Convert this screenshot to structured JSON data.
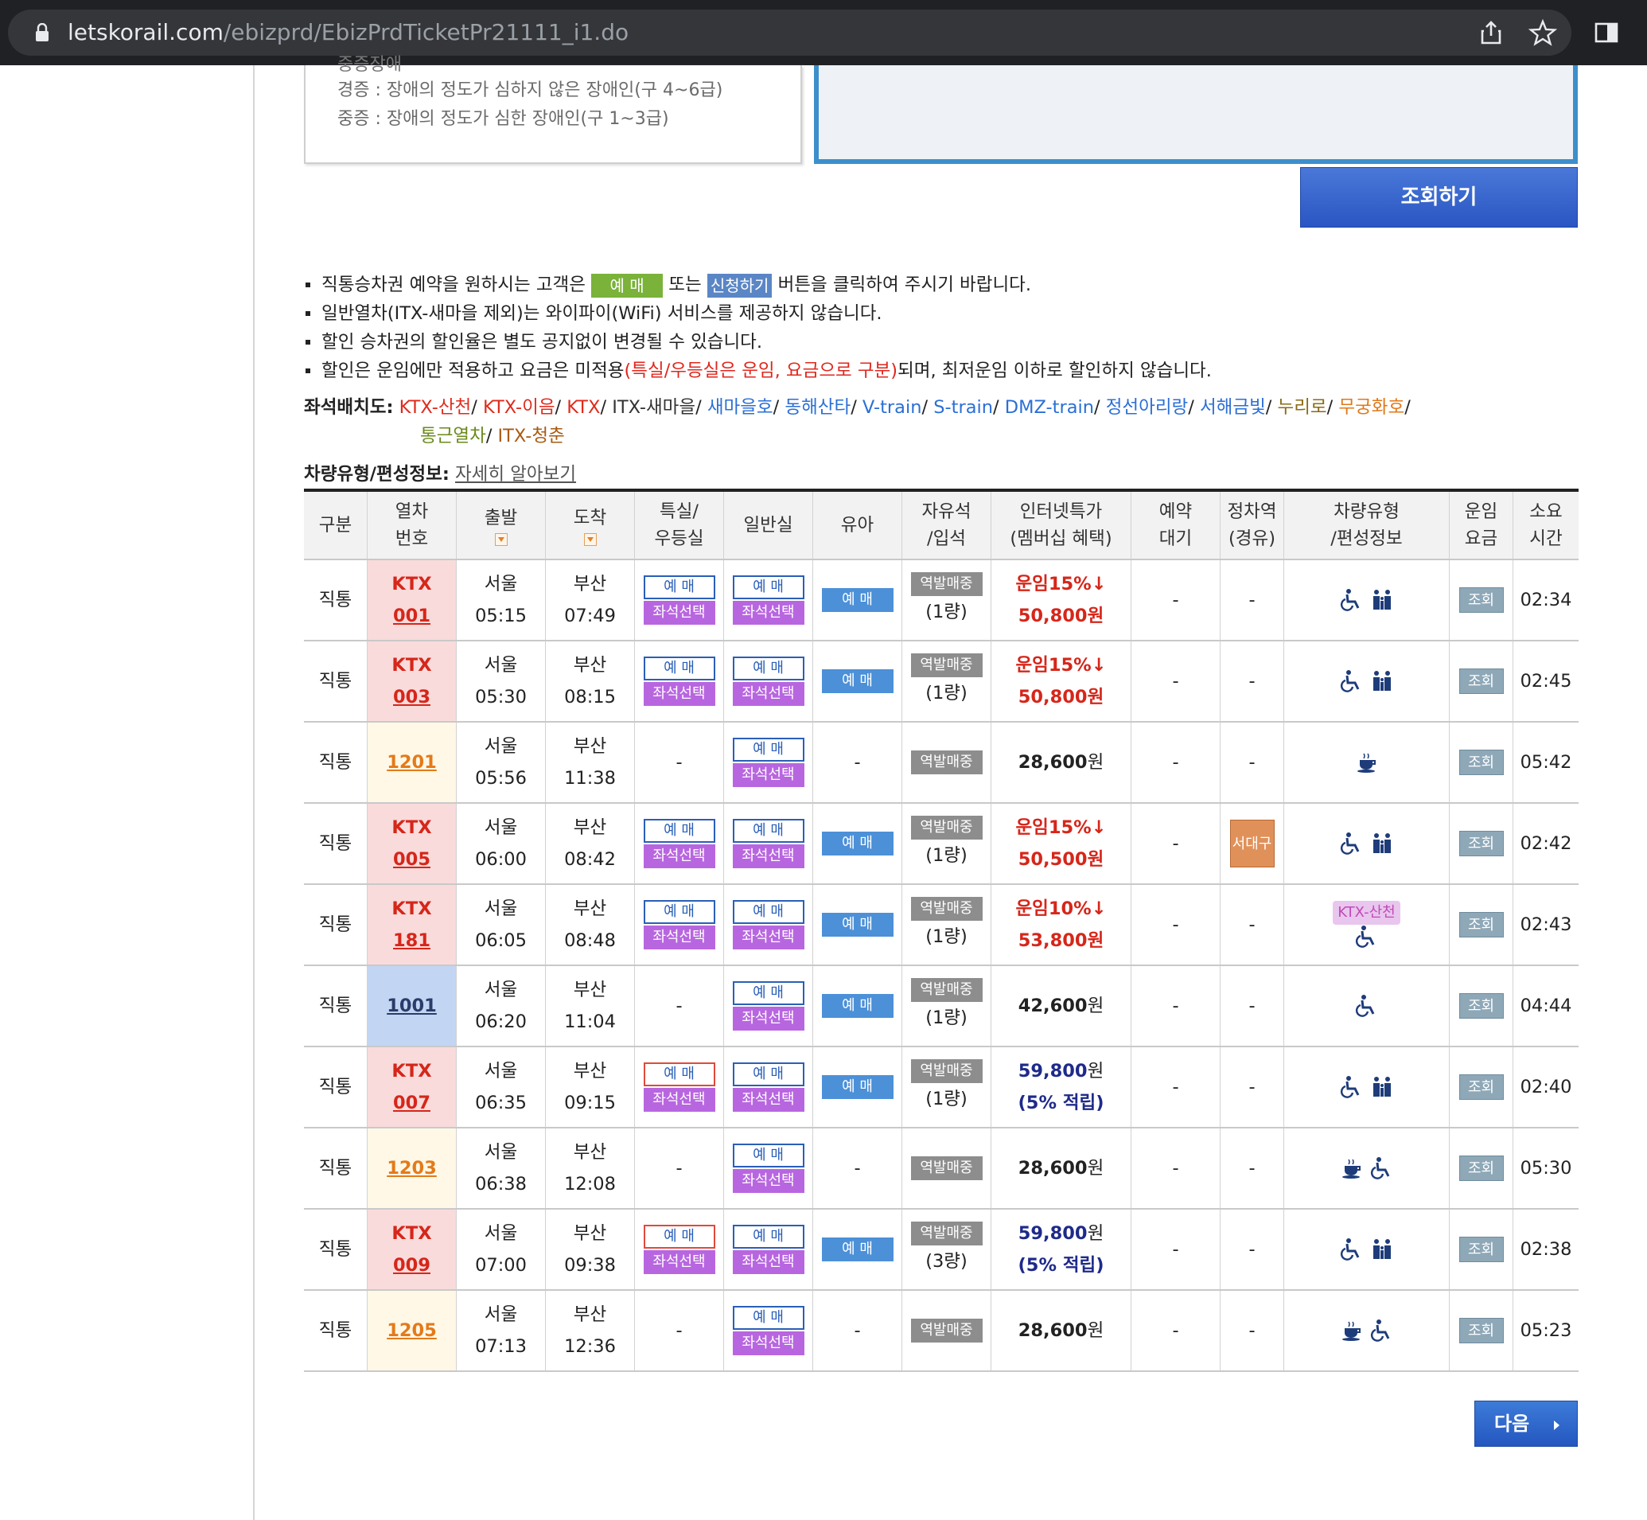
{
  "browser": {
    "url_domain": "letskorail.com",
    "url_path": "/ebizprd/EbizPrdTicketPr21111_i1.do"
  },
  "disability": {
    "cut_line": "중증장애",
    "light": "경증 : 장애의 정도가 심하지 않은 장애인(구 4~6급)",
    "severe": "중증 : 장애의 정도가 심한 장애인(구 1~3급)"
  },
  "search_button": "조회하기",
  "notices": {
    "n1_a": "직통승차권 예약을 원하시는 고객은 ",
    "n1_btn1": "예 매",
    "n1_b": " 또는 ",
    "n1_btn2": "신청하기",
    "n1_c": " 버튼을 클릭하여 주시기 바랍니다.",
    "n2": "일반열차(ITX-새마을 제외)는 와이파이(WiFi) 서비스를 제공하지 않습니다.",
    "n3": "할인 승차권의 할인율은 별도 공지없이 변경될 수 있습니다.",
    "n4_a": "할인은 운임에만 적용하고 요금은 미적용",
    "n4_red": "(특실/우등실은 운임, 요금으로 구분)",
    "n4_b": "되며, 최저운임 이하로 할인하지 않습니다."
  },
  "seatmap": {
    "label": "좌석배치도:",
    "links": [
      "KTX-산천",
      "KTX-이음",
      "KTX",
      "ITX-새마을",
      "새마을호",
      "동해산타",
      "V-train",
      "S-train",
      "DMZ-train",
      "정선아리랑",
      "서해금빛",
      "누리로",
      "무궁화호",
      "통근열차",
      "ITX-청춘"
    ]
  },
  "carinfo": {
    "label": "차량유형/편성정보:",
    "link": "자세히 알아보기"
  },
  "headers": {
    "type": "구분",
    "train_no_1": "열차",
    "train_no_2": "번호",
    "dep": "출발",
    "arr": "도착",
    "first_1": "특실/",
    "first_2": "우등실",
    "general": "일반실",
    "infant": "유아",
    "free_1": "자유석",
    "free_2": "/입석",
    "internet_1": "인터넷특가",
    "internet_2": "(멤버십 혜택)",
    "wait_1": "예약",
    "wait_2": "대기",
    "stop_1": "정차역",
    "stop_2": "(경유)",
    "car_1": "차량유형",
    "car_2": "/편성정보",
    "fare_1": "운임",
    "fare_2": "요금",
    "dur_1": "소요",
    "dur_2": "시간"
  },
  "labels": {
    "reserve": "예 매",
    "seat_select": "좌석선택",
    "station_sale": "역발매중",
    "inquiry": "조회",
    "dash": "-",
    "won": "원"
  },
  "rows": [
    {
      "type": "직통",
      "kind": "KTX",
      "train": "KTX",
      "num": "001",
      "dep_st": "서울",
      "dep_t": "05:15",
      "arr_st": "부산",
      "arr_t": "07:49",
      "free": "(1량)",
      "fare_top": "운임15%↓",
      "fare_val": "50,800",
      "stop": "-",
      "wait": "-",
      "dur": "02:34"
    },
    {
      "type": "직통",
      "kind": "KTX",
      "train": "KTX",
      "num": "003",
      "dep_st": "서울",
      "dep_t": "05:30",
      "arr_st": "부산",
      "arr_t": "08:15",
      "free": "(1량)",
      "fare_top": "운임15%↓",
      "fare_val": "50,800",
      "stop": "-",
      "wait": "-",
      "dur": "02:45"
    },
    {
      "type": "직통",
      "kind": "ITX",
      "train": "",
      "num": "1201",
      "dep_st": "서울",
      "dep_t": "05:56",
      "arr_st": "부산",
      "arr_t": "11:38",
      "free": "",
      "fare_top": "",
      "fare_val": "28,600",
      "stop": "-",
      "wait": "-",
      "dur": "05:42"
    },
    {
      "type": "직통",
      "kind": "KTX",
      "train": "KTX",
      "num": "005",
      "dep_st": "서울",
      "dep_t": "06:00",
      "arr_st": "부산",
      "arr_t": "08:42",
      "free": "(1량)",
      "fare_top": "운임15%↓",
      "fare_val": "50,500",
      "stop": "서대구",
      "wait": "-",
      "dur": "02:42"
    },
    {
      "type": "직통",
      "kind": "KTX",
      "train": "KTX",
      "num": "181",
      "dep_st": "서울",
      "dep_t": "06:05",
      "arr_st": "부산",
      "arr_t": "08:48",
      "free": "(1량)",
      "fare_top": "운임10%↓",
      "fare_val": "53,800",
      "stop": "-",
      "wait": "-",
      "dur": "02:43",
      "car_badge": "KTX-산천"
    },
    {
      "type": "직통",
      "kind": "MU",
      "train": "",
      "num": "1001",
      "dep_st": "서울",
      "dep_t": "06:20",
      "arr_st": "부산",
      "arr_t": "11:04",
      "free": "(1량)",
      "fare_top": "",
      "fare_val": "42,600",
      "stop": "-",
      "wait": "-",
      "dur": "04:44"
    },
    {
      "type": "직통",
      "kind": "KTX",
      "train": "KTX",
      "num": "007",
      "dep_st": "서울",
      "dep_t": "06:35",
      "arr_st": "부산",
      "arr_t": "09:15",
      "free": "(1량)",
      "fare_top": "",
      "fare_val": "59,800",
      "fare_sub": "(5% 적립)",
      "stop": "-",
      "wait": "-",
      "dur": "02:40"
    },
    {
      "type": "직통",
      "kind": "ITX",
      "train": "",
      "num": "1203",
      "dep_st": "서울",
      "dep_t": "06:38",
      "arr_st": "부산",
      "arr_t": "12:08",
      "free": "",
      "fare_top": "",
      "fare_val": "28,600",
      "stop": "-",
      "wait": "-",
      "dur": "05:30"
    },
    {
      "type": "직통",
      "kind": "KTX",
      "train": "KTX",
      "num": "009",
      "dep_st": "서울",
      "dep_t": "07:00",
      "arr_st": "부산",
      "arr_t": "09:38",
      "free": "(3량)",
      "fare_top": "",
      "fare_val": "59,800",
      "fare_sub": "(5% 적립)",
      "stop": "-",
      "wait": "-",
      "dur": "02:38"
    },
    {
      "type": "직통",
      "kind": "ITX",
      "train": "",
      "num": "1205",
      "dep_st": "서울",
      "dep_t": "07:13",
      "arr_st": "부산",
      "arr_t": "12:36",
      "free": "",
      "fare_top": "",
      "fare_val": "28,600",
      "stop": "-",
      "wait": "-",
      "dur": "05:23"
    }
  ],
  "next_button": "다음",
  "colors": {
    "ktx_bg": "#f9dbdb",
    "itx_bg": "#fff8e6",
    "mugunghwa_bg": "#c2d5f2",
    "reserve_blue": "#2a5fb8",
    "seat_purple": "#b866e0"
  }
}
